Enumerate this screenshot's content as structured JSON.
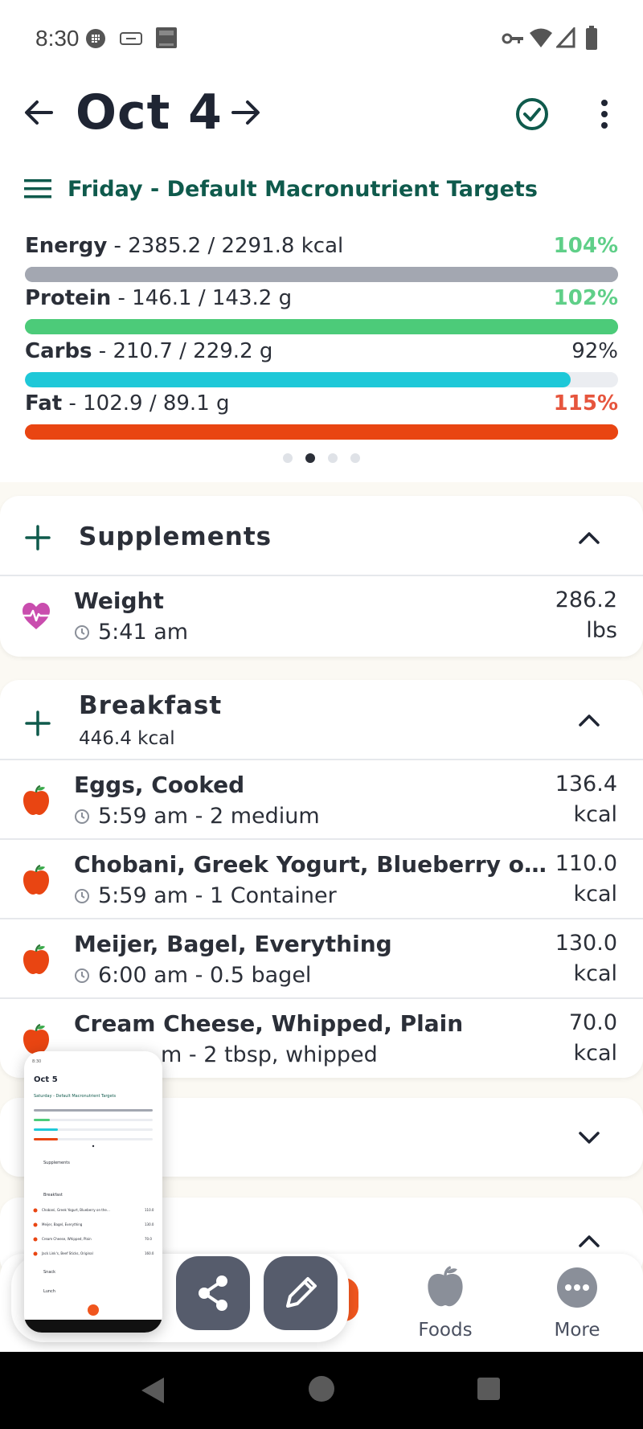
{
  "status_bar": {
    "time": "8:30"
  },
  "header": {
    "date": "Oct 4",
    "target_label": "Friday - Default Macronutrient Targets"
  },
  "macros": [
    {
      "name": "Energy",
      "detail": " - 2385.2 / 2291.8 kcal",
      "percent": "104%",
      "fill_fraction": 1.0,
      "bar_color": "#a3a7b1",
      "pct_color": "#5fcf88"
    },
    {
      "name": "Protein",
      "detail": " - 146.1 / 143.2 g",
      "percent": "102%",
      "fill_fraction": 1.0,
      "bar_color": "#4ccb79",
      "pct_color": "#5fcf88"
    },
    {
      "name": "Carbs",
      "detail": " - 210.7 / 229.2 g",
      "percent": "92%",
      "fill_fraction": 0.92,
      "bar_color": "#1ec8d8",
      "pct_color": "#2b2f38"
    },
    {
      "name": "Fat",
      "detail": " - 102.9 / 89.1 g",
      "percent": "115%",
      "fill_fraction": 1.0,
      "bar_color": "#e94512",
      "pct_color": "#e6553d"
    }
  ],
  "pager": {
    "count": 4,
    "active": 1
  },
  "supplements": {
    "title": "Supplements",
    "entries": [
      {
        "title": "Weight",
        "time": "5:41 am",
        "value": "286.2",
        "unit": "lbs",
        "icon": "heart-pulse-icon"
      }
    ]
  },
  "breakfast": {
    "title": "Breakfast",
    "subtitle": "446.4 kcal",
    "entries": [
      {
        "title": "Eggs, Cooked",
        "time": "5:59 am - 2 medium",
        "value": "136.4",
        "unit": "kcal",
        "icon": "apple-icon"
      },
      {
        "title": "Chobani, Greek Yogurt, Blueberry on the…",
        "time": "5:59 am - 1 Container",
        "value": "110.0",
        "unit": "kcal",
        "icon": "apple-icon"
      },
      {
        "title": "Meijer, Bagel, Everything",
        "time": "6:00 am - 0.5 bagel",
        "value": "130.0",
        "unit": "kcal",
        "icon": "apple-icon"
      },
      {
        "title": "Cream Cheese, Whipped, Plain",
        "time": "m - 2 tbsp, whipped",
        "value": "70.0",
        "unit": "kcal",
        "icon": "apple-icon"
      }
    ]
  },
  "bottom_nav": {
    "foods_label": "Foods",
    "more_label": "More"
  },
  "thumbnail": {
    "date": "Oct 5",
    "target_label": "Saturday - Default Macronutrient Targets",
    "sections": [
      "Supplements",
      "Breakfast",
      "Snack",
      "Lunch"
    ],
    "foods": [
      {
        "title": "Chobani, Greek Yogurt, Blueberry on the…",
        "value": "110.0"
      },
      {
        "title": "Meijer, Bagel, Everything",
        "value": "130.0"
      },
      {
        "title": "Cream Cheese, Whipped, Plain",
        "value": "70.0"
      },
      {
        "title": "Jack Link's, Beef Sticks, Original",
        "value": "160.0"
      }
    ]
  },
  "colors": {
    "accent_teal": "#0f5a4c",
    "orange": "#f0561e",
    "fab": "#565c6c",
    "heart": "#c94dae",
    "apple": "#e94512"
  }
}
